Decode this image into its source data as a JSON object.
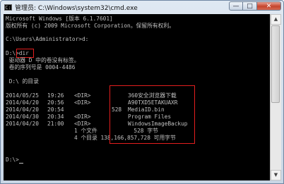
{
  "window": {
    "title": "管理员: C:\\Windows\\system32\\cmd.exe",
    "icon": "cmd-prompt-icon",
    "minimize_glyph": "—",
    "maximize_glyph": "□",
    "close_glyph": "✕"
  },
  "console": {
    "header_line1": "Microsoft Windows [版本 6.1.7601]",
    "header_line2": "版权所有 (c) 2009 Microsoft Corporation。保留所有权利。",
    "prompt1": "C:\\Users\\Administrator>d:",
    "prompt2_path": "D:\\>",
    "prompt2_cmd": "dir",
    "volume_label": " 驱动器 D 中的卷没有标签。",
    "volume_serial": " 卷的序列号是 0004-4486",
    "dir_of": " D:\\ 的目录",
    "entries": [
      {
        "date": "2014/05/25",
        "time": "19:26",
        "type": "<DIR>",
        "size": "",
        "name": "360安全浏览器下载"
      },
      {
        "date": "2014/04/20",
        "time": "20:56",
        "type": "<DIR>",
        "size": "",
        "name": "A90TXD5ETAKUAXR"
      },
      {
        "date": "2014/04/20",
        "time": "20:54",
        "type": "",
        "size": "528",
        "name": "MediaID.bin"
      },
      {
        "date": "2014/04/30",
        "time": "20:34",
        "type": "<DIR>",
        "size": "",
        "name": "Program Files"
      },
      {
        "date": "2014/04/20",
        "time": "21:00",
        "type": "<DIR>",
        "size": "",
        "name": "WindowsImageBackup"
      }
    ],
    "summary_files": "1 个文件           528 字节",
    "summary_dirs": "4 个目录 138,166,857,728 可用字节",
    "final_prompt": "D:\\>"
  },
  "scrollbar": {
    "up_glyph": "▲",
    "down_glyph": "▼"
  },
  "highlight_color": "#e31e1e"
}
